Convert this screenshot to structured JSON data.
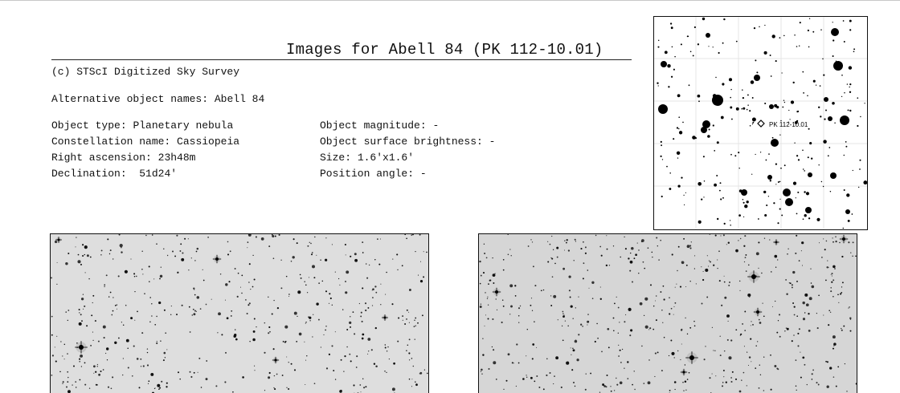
{
  "page": {
    "title": "Images for Abell 84 (PK 112-10.01)",
    "credit": "(c) STScI Digitized Sky Survey",
    "alt_names_label": "Alternative object names:",
    "alt_names_value": "Abell 84"
  },
  "left_props": [
    {
      "label": "Object type:",
      "value": "Planetary nebula"
    },
    {
      "label": "Constellation name:",
      "value": "Cassiopeia"
    },
    {
      "label": "Right ascension:",
      "value": "23h48m"
    },
    {
      "label": "Declination:",
      "value": " 51d24'"
    }
  ],
  "right_props": [
    {
      "label": "Object magnitude:",
      "value": "-"
    },
    {
      "label": "Object surface brightness:",
      "value": "-"
    },
    {
      "label": "Size:",
      "value": "1.6'x1.6'"
    },
    {
      "label": "Position angle:",
      "value": "-"
    }
  ],
  "finder_chart": {
    "target_label": "PK 112-10.01"
  },
  "images": [
    {
      "name": "dss-image-wide"
    },
    {
      "name": "dss-image-narrow"
    }
  ]
}
